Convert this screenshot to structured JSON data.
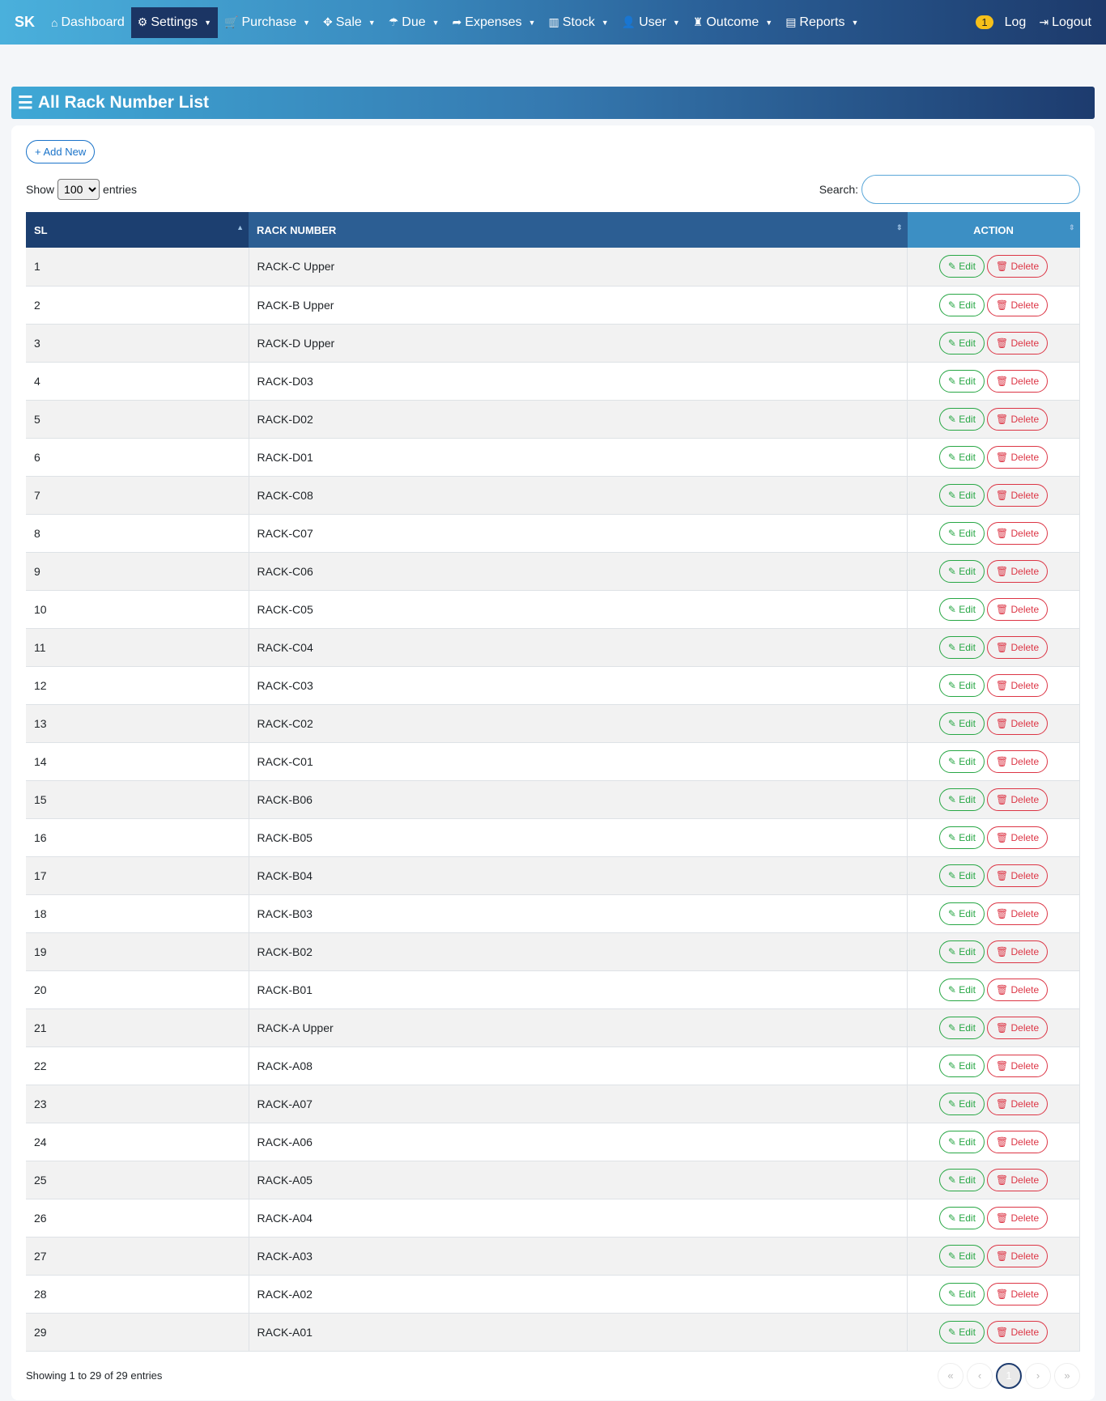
{
  "nav": {
    "brand": "SK",
    "items": [
      {
        "label": "Dashboard",
        "icon": "home-icon",
        "glyph": "⌂",
        "caret": false
      },
      {
        "label": "Settings",
        "icon": "gears-icon",
        "glyph": "⚙",
        "caret": true,
        "active": true
      },
      {
        "label": "Purchase",
        "icon": "cart-icon",
        "glyph": "🛒",
        "caret": true
      },
      {
        "label": "Sale",
        "icon": "arrows-icon",
        "glyph": "✥",
        "caret": true
      },
      {
        "label": "Due",
        "icon": "umbrella-icon",
        "glyph": "☂",
        "caret": true
      },
      {
        "label": "Expenses",
        "icon": "share-icon",
        "glyph": "➦",
        "caret": true
      },
      {
        "label": "Stock",
        "icon": "bar-chart-icon",
        "glyph": "▥",
        "caret": true
      },
      {
        "label": "User",
        "icon": "user-icon",
        "glyph": "👤",
        "caret": true
      },
      {
        "label": "Outcome",
        "icon": "bag-icon",
        "glyph": "♜",
        "caret": true
      },
      {
        "label": "Reports",
        "icon": "pdf-icon",
        "glyph": "▤",
        "caret": true
      }
    ],
    "log_badge": "1",
    "log": "Log",
    "logout": "Logout"
  },
  "page": {
    "title": "All Rack Number List",
    "add_new": "+ Add New",
    "show": "Show",
    "entries_value": "100",
    "entries": "entries",
    "search_label": "Search:",
    "search_value": ""
  },
  "table": {
    "headers": [
      "SL",
      "RACK NUMBER",
      "ACTION"
    ],
    "edit": "Edit",
    "delete": "Delete",
    "rows": [
      [
        "1",
        "RACK-C Upper"
      ],
      [
        "2",
        "RACK-B Upper"
      ],
      [
        "3",
        "RACK-D Upper"
      ],
      [
        "4",
        "RACK-D03"
      ],
      [
        "5",
        "RACK-D02"
      ],
      [
        "6",
        "RACK-D01"
      ],
      [
        "7",
        "RACK-C08"
      ],
      [
        "8",
        "RACK-C07"
      ],
      [
        "9",
        "RACK-C06"
      ],
      [
        "10",
        "RACK-C05"
      ],
      [
        "11",
        "RACK-C04"
      ],
      [
        "12",
        "RACK-C03"
      ],
      [
        "13",
        "RACK-C02"
      ],
      [
        "14",
        "RACK-C01"
      ],
      [
        "15",
        "RACK-B06"
      ],
      [
        "16",
        "RACK-B05"
      ],
      [
        "17",
        "RACK-B04"
      ],
      [
        "18",
        "RACK-B03"
      ],
      [
        "19",
        "RACK-B02"
      ],
      [
        "20",
        "RACK-B01"
      ],
      [
        "21",
        "RACK-A Upper"
      ],
      [
        "22",
        "RACK-A08"
      ],
      [
        "23",
        "RACK-A07"
      ],
      [
        "24",
        "RACK-A06"
      ],
      [
        "25",
        "RACK-A05"
      ],
      [
        "26",
        "RACK-A04"
      ],
      [
        "27",
        "RACK-A03"
      ],
      [
        "28",
        "RACK-A02"
      ],
      [
        "29",
        "RACK-A01"
      ]
    ]
  },
  "footer": {
    "info": "Showing 1 to 29 of 29 entries",
    "pages": [
      "«",
      "‹",
      "1",
      "›",
      "»"
    ],
    "current": "1"
  }
}
